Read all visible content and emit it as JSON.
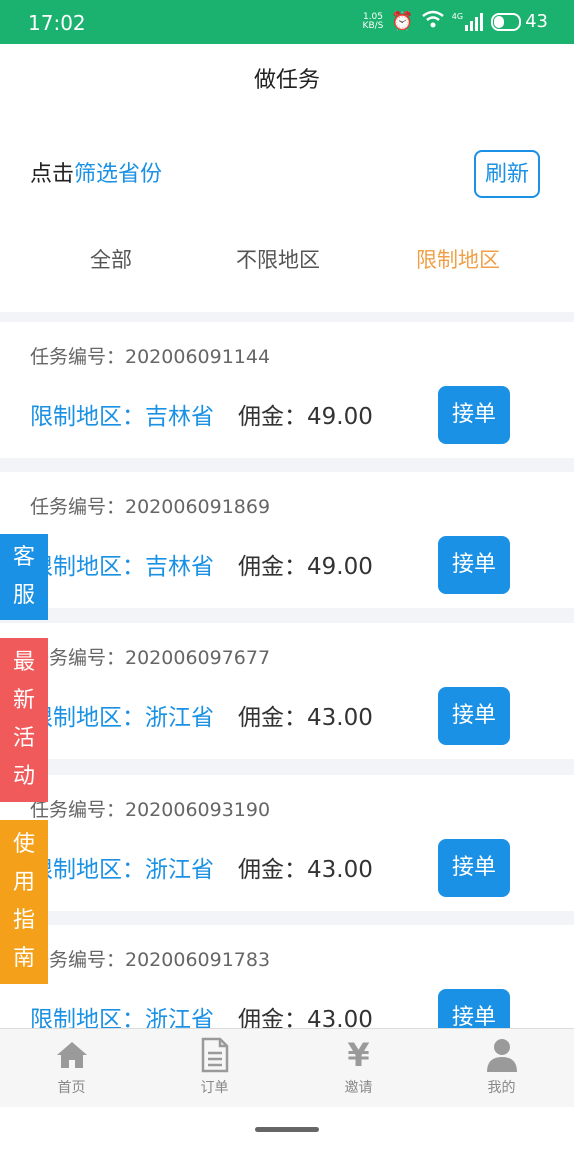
{
  "status_bar": {
    "time": "17:02",
    "net_speed_top": "1.05",
    "net_speed_bottom": "KB/S",
    "signal_label": "4G",
    "battery": "43"
  },
  "page_title": "做任务",
  "filter": {
    "prompt_prefix": "点击",
    "prompt_link": "筛选省份",
    "refresh_label": "刷新"
  },
  "tabs": [
    {
      "label": "全部",
      "active": false
    },
    {
      "label": "不限地区",
      "active": false
    },
    {
      "label": "限制地区",
      "active": true
    }
  ],
  "tasks": [
    {
      "code": "任务编号：202006091144",
      "region": "限制地区：吉林省",
      "commission": "佣金：49.00",
      "action": "接单"
    },
    {
      "code": "任务编号：202006091869",
      "region": "限制地区：吉林省",
      "commission": "佣金：49.00",
      "action": "接单"
    },
    {
      "code": "任务编号：202006097677",
      "region": "限制地区：浙江省",
      "commission": "佣金：43.00",
      "action": "接单"
    },
    {
      "code": "任务编号：202006093190",
      "region": "限制地区：浙江省",
      "commission": "佣金：43.00",
      "action": "接单"
    },
    {
      "code": "任务编号：202006091783",
      "region": "限制地区：浙江省",
      "commission": "佣金：43.00",
      "action": "接单"
    }
  ],
  "float_tabs": [
    {
      "chars": [
        "客",
        "服"
      ],
      "color": "#1a91e4"
    },
    {
      "chars": [
        "最",
        "新",
        "活",
        "动"
      ],
      "color": "#f05a5a"
    },
    {
      "chars": [
        "使",
        "用",
        "指",
        "南"
      ],
      "color": "#f5a01a"
    }
  ],
  "bottom_nav": [
    {
      "label": "首页",
      "icon": "home-icon"
    },
    {
      "label": "订单",
      "icon": "document-icon"
    },
    {
      "label": "邀请",
      "icon": "yen-icon"
    },
    {
      "label": "我的",
      "icon": "user-icon"
    }
  ],
  "colors": {
    "status_bar": "#1bb26f",
    "accent": "#1a91e4",
    "active_tab": "#f0a048"
  }
}
